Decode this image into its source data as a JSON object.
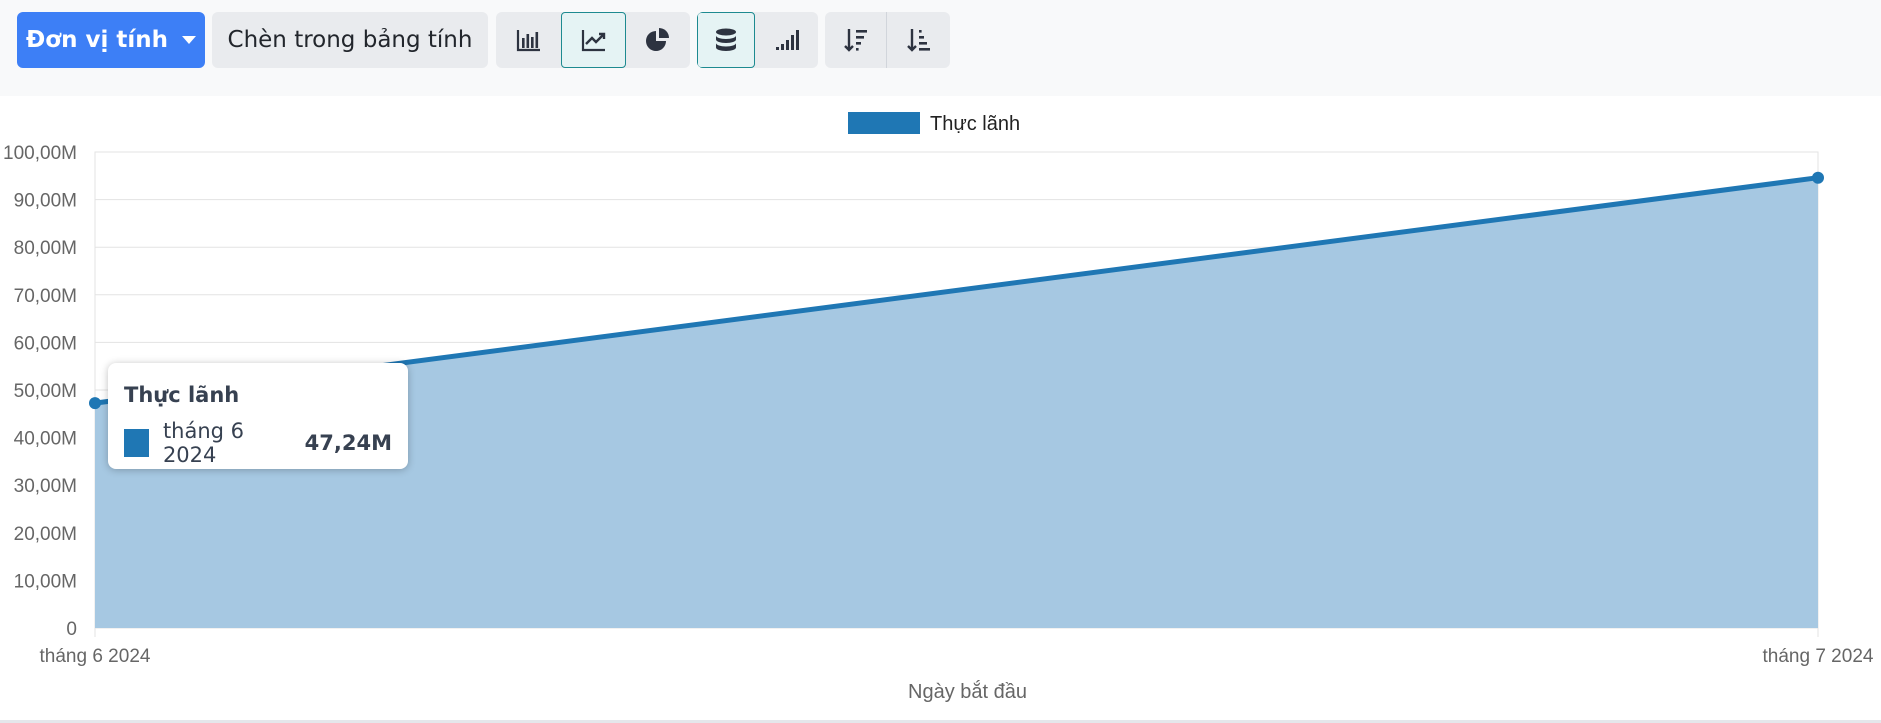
{
  "toolbar": {
    "measure_label": "Đơn vị tính",
    "insert_label": "Chèn trong bảng tính",
    "chart_type_icons": [
      "bar-chart-icon",
      "line-chart-icon",
      "pie-chart-icon"
    ],
    "active_chart_type": "line",
    "stack_icons": [
      "stacked-database-icon",
      "cumulative-bars-icon"
    ],
    "sort_icons": [
      "sort-descending-icon",
      "sort-ascending-icon"
    ],
    "accent_color": "#3d7ff6"
  },
  "tooltip": {
    "title": "Thực lãnh",
    "label": "tháng 6 2024",
    "value": "47,24M"
  },
  "chart_data": {
    "type": "area",
    "title": "",
    "xlabel": "Ngày bắt đầu",
    "ylabel": "",
    "categories": [
      "tháng 6 2024",
      "tháng 7 2024"
    ],
    "series": [
      {
        "name": "Thực lãnh",
        "values": [
          47.24,
          94.6
        ],
        "color": "#1f77b4",
        "fill": "#a6c8e2"
      }
    ],
    "ylim": [
      0,
      100
    ],
    "y_ticks": [
      0,
      10,
      20,
      30,
      40,
      50,
      60,
      70,
      80,
      90,
      100
    ],
    "y_tick_labels": [
      "0",
      "10,00M",
      "20,00M",
      "30,00M",
      "40,00M",
      "50,00M",
      "60,00M",
      "70,00M",
      "80,00M",
      "90,00M",
      "100,00M"
    ],
    "unit": "M",
    "grid": true,
    "legend_position": "top"
  }
}
